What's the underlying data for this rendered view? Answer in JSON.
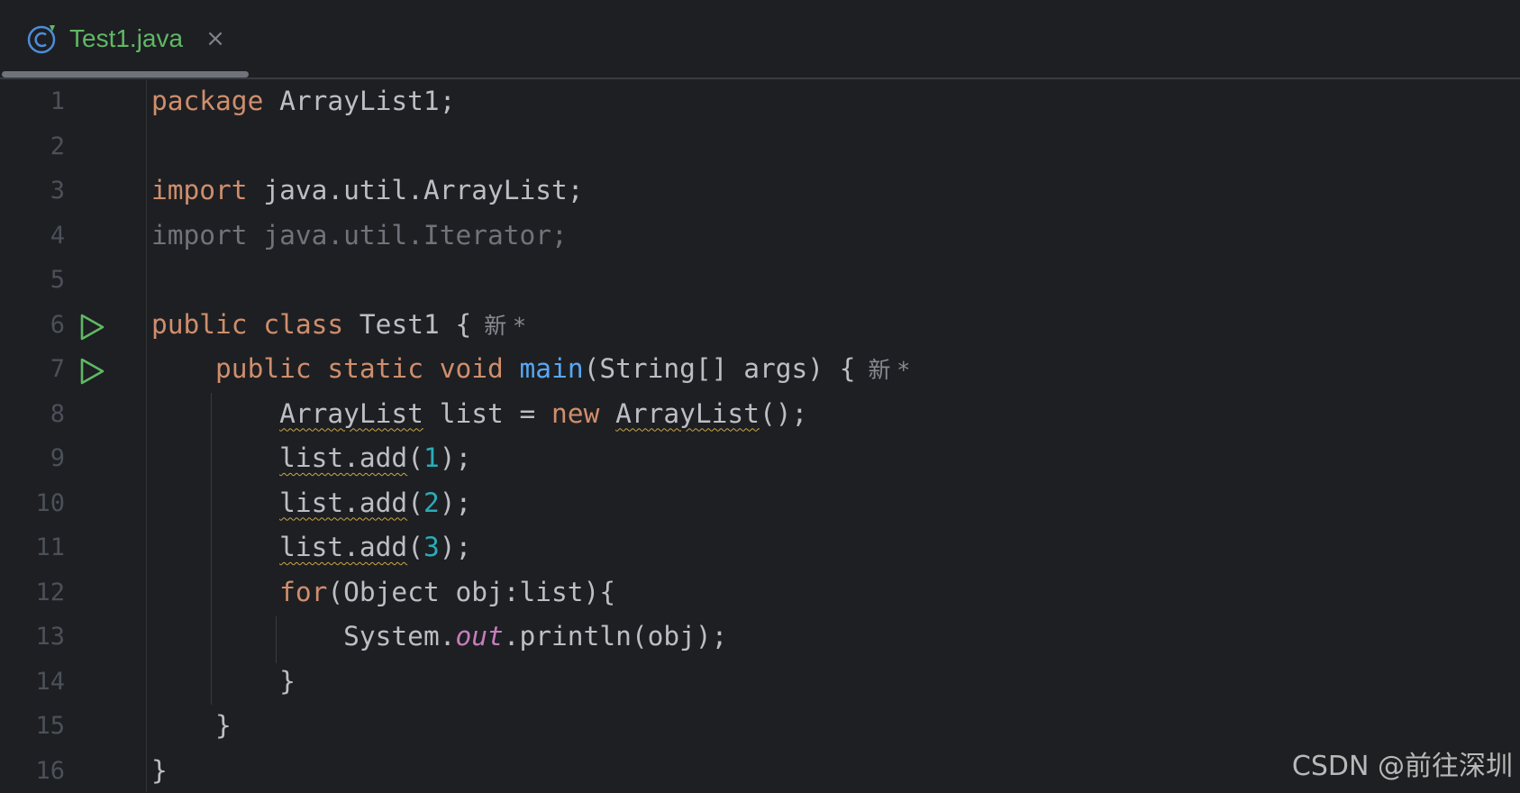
{
  "tab": {
    "icon": "java-class-icon",
    "label": "Test1.java",
    "close_glyph": "×",
    "label_color": "#5fb865"
  },
  "editor": {
    "line_numbers": [
      "1",
      "2",
      "3",
      "4",
      "5",
      "6",
      "7",
      "8",
      "9",
      "10",
      "11",
      "12",
      "13",
      "14",
      "15",
      "16"
    ],
    "run_markers_on_lines": [
      6,
      7
    ],
    "code": {
      "l1_kw": "package",
      "l1_rest": " ArrayList1;",
      "l3_kw": "import",
      "l3_rest": " java.util.ArrayList;",
      "l4_text": "import java.util.Iterator;",
      "l6_kw1": "public",
      "l6_kw2": "class",
      "l6_rest": " Test1 {",
      "l6_hint": "新 *",
      "l7_kw1": "public",
      "l7_kw2": "static",
      "l7_kw3": "void",
      "l7_fn": "main",
      "l7_rest": "(String[] args) {",
      "l7_hint": "新 *",
      "l8_type": "ArrayList",
      "l8_mid": " list = ",
      "l8_kw": "new",
      "l8_ctor": "ArrayList",
      "l8_end": "();",
      "l9_call": "list.add",
      "l9_open": "(",
      "l9_num": "1",
      "l9_close": ");",
      "l10_call": "list.add",
      "l10_open": "(",
      "l10_num": "2",
      "l10_close": ");",
      "l11_call": "list.add",
      "l11_open": "(",
      "l11_num": "3",
      "l11_close": ");",
      "l12_kw": "for",
      "l12_rest": "(Object obj:list){",
      "l13_pre": "System.",
      "l13_field": "out",
      "l13_post": ".println(obj);",
      "l14_text": "}",
      "l15_text": "}",
      "l16_text": "}"
    },
    "colors": {
      "background": "#1e1f22",
      "keyword": "#cf8e6d",
      "function": "#56a8f5",
      "number": "#2aacb8",
      "static_field": "#c77dbb",
      "run_marker": "#5fb865"
    }
  },
  "watermark": "CSDN @前往深圳"
}
